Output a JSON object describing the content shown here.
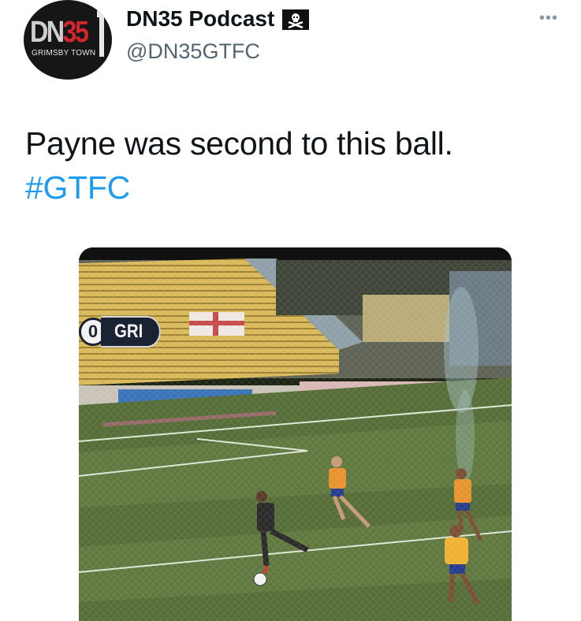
{
  "author": {
    "display_name": "DN35 Podcast",
    "handle": "@DN35GTFC",
    "avatar": {
      "logo_main": "DN",
      "logo_accent": "35",
      "logo_sub": "GRIMSBY TOWN"
    },
    "flag_icon": "pirate-flag-icon"
  },
  "menu": {
    "more_label": "•••"
  },
  "tweet": {
    "text": "Payne was second to this ball.",
    "hashtag": "#GTFC"
  },
  "media": {
    "scorebug": {
      "score": "0",
      "team": "GRI"
    }
  },
  "colors": {
    "hashtag": "#1d9bf0",
    "handle": "#536471",
    "text": "#0f1419"
  }
}
